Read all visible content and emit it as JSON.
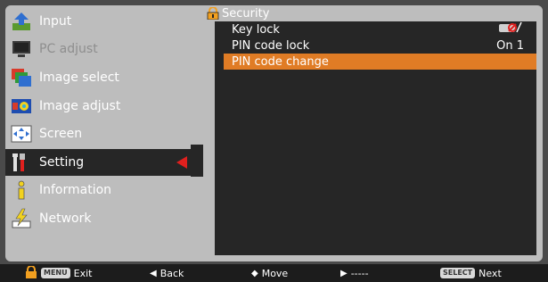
{
  "menu": {
    "items": [
      {
        "label": "Input",
        "icon": "input-icon",
        "state": "normal"
      },
      {
        "label": "PC adjust",
        "icon": "pc-adjust-icon",
        "state": "disabled"
      },
      {
        "label": "Image select",
        "icon": "image-select-icon",
        "state": "normal"
      },
      {
        "label": "Image adjust",
        "icon": "image-adjust-icon",
        "state": "normal"
      },
      {
        "label": "Screen",
        "icon": "screen-icon",
        "state": "normal"
      },
      {
        "label": "Setting",
        "icon": "setting-icon",
        "state": "active"
      },
      {
        "label": "Information",
        "icon": "information-icon",
        "state": "normal"
      },
      {
        "label": "Network",
        "icon": "network-icon",
        "state": "normal"
      }
    ]
  },
  "security": {
    "title": "Security",
    "rows": [
      {
        "label": "Key lock",
        "value": "",
        "icon": "key-lock-icon"
      },
      {
        "label": "PIN code lock",
        "value": "On 1"
      },
      {
        "label": "PIN code change",
        "value": "",
        "selected": true
      }
    ]
  },
  "footer": {
    "exit_key": "MENU",
    "exit": "Exit",
    "back": "Back",
    "move": "Move",
    "dashes": "-----",
    "next_key": "SELECT",
    "next": "Next"
  },
  "colors": {
    "panel_bg": "#bdbdbd",
    "dark_bg": "#262626",
    "highlight": "#e07c25",
    "pointer": "#e0201e"
  }
}
